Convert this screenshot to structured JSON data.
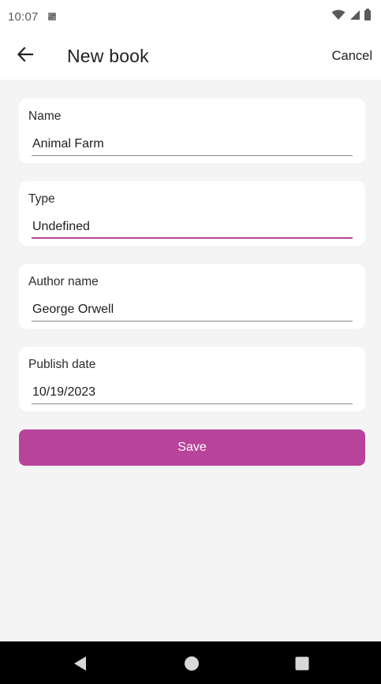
{
  "status_bar": {
    "time": "10:07",
    "app_icon": "sync-icon",
    "icons": [
      "wifi-icon",
      "cell-signal-icon",
      "battery-icon"
    ]
  },
  "app_bar": {
    "back_icon": "arrow-left-icon",
    "title": "New book",
    "cancel_label": "Cancel"
  },
  "form": {
    "fields": [
      {
        "label": "Name",
        "value": "Animal Farm",
        "focused": false
      },
      {
        "label": "Type",
        "value": "Undefined",
        "focused": true
      },
      {
        "label": "Author name",
        "value": "George Orwell",
        "focused": false
      },
      {
        "label": "Publish date",
        "value": "10/19/2023",
        "focused": false
      }
    ],
    "save_label": "Save"
  },
  "nav_bar": {
    "buttons": [
      "back-triangle-icon",
      "home-circle-icon",
      "recents-square-icon"
    ]
  },
  "colors": {
    "accent": "#b8439a",
    "background": "#f4f4f4",
    "card": "#ffffff",
    "nav": "#000000"
  }
}
